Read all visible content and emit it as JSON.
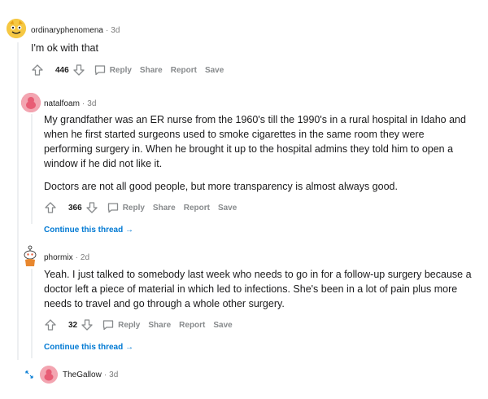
{
  "comments": [
    {
      "username": "ordinaryphenomena",
      "time": "3d",
      "body": [
        "I'm ok with that"
      ],
      "votes": "446",
      "actions": [
        "Reply",
        "Share",
        "Report",
        "Save"
      ]
    },
    {
      "username": "natalfoam",
      "time": "3d",
      "body": [
        "My grandfather was an ER nurse from the 1960's till the 1990's in a rural hospital in Idaho and when he first started surgeons used to smoke cigarettes in the same room they were performing surgery in. When he brought it up to the hospital admins they told him to open a window if he did not like it.",
        "Doctors are not all good people, but more transparency is almost always good."
      ],
      "votes": "366",
      "actions": [
        "Reply",
        "Share",
        "Report",
        "Save"
      ],
      "continue_label": "Continue this thread →"
    },
    {
      "username": "phormix",
      "time": "2d",
      "body": [
        "Yeah. I just talked to somebody last week who needs to go in for a follow-up surgery because a doctor left a piece of material in which led to infections. She's been in a lot of pain plus more needs to travel and go through a whole other surgery."
      ],
      "votes": "32",
      "actions": [
        "Reply",
        "Share",
        "Report",
        "Save"
      ],
      "continue_label": "Continue this thread →"
    },
    {
      "username": "TheGallow",
      "time": "3d"
    }
  ],
  "separator": "·",
  "colors": {
    "avatar_yellow": "#f6c843",
    "avatar_pink": "#e85d75",
    "link_blue": "#0079d3",
    "thread_line": "#edeff1"
  },
  "icons": {
    "upvote": "arrow-up-icon",
    "downvote": "arrow-down-icon",
    "reply": "speech-bubble-icon",
    "expand": "expand-arrows-icon"
  }
}
